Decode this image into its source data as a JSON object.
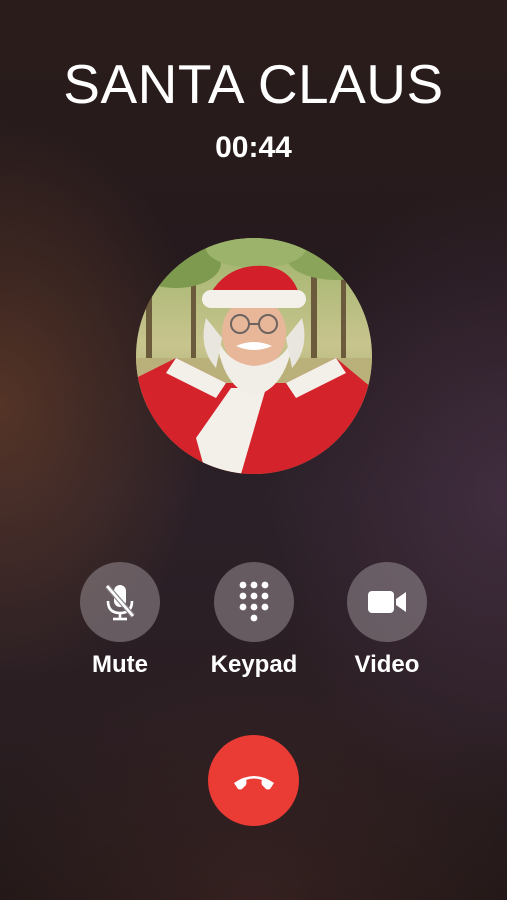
{
  "call": {
    "caller_name": "SANTA CLAUS",
    "duration": "00:44"
  },
  "avatar": {
    "icon": "santa-photo"
  },
  "controls": [
    {
      "label": "Mute",
      "icon": "mic-off-icon"
    },
    {
      "label": "Keypad",
      "icon": "keypad-icon"
    },
    {
      "label": "Video",
      "icon": "video-camera-icon"
    }
  ],
  "end_call": {
    "icon": "phone-hangup-icon",
    "color": "#eb3b35"
  }
}
